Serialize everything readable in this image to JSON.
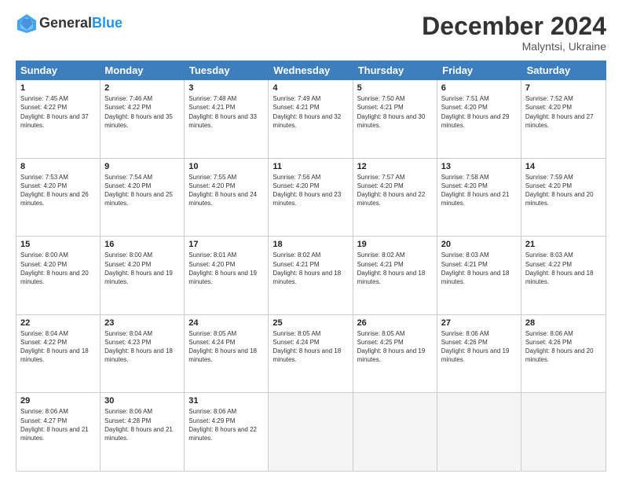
{
  "header": {
    "logo_general": "General",
    "logo_blue": "Blue",
    "month_title": "December 2024",
    "location": "Malyntsi, Ukraine"
  },
  "weekdays": [
    "Sunday",
    "Monday",
    "Tuesday",
    "Wednesday",
    "Thursday",
    "Friday",
    "Saturday"
  ],
  "rows": [
    [
      {
        "day": "1",
        "sunrise": "7:45 AM",
        "sunset": "4:22 PM",
        "daylight": "8 hours and 37 minutes."
      },
      {
        "day": "2",
        "sunrise": "7:46 AM",
        "sunset": "4:22 PM",
        "daylight": "8 hours and 35 minutes."
      },
      {
        "day": "3",
        "sunrise": "7:48 AM",
        "sunset": "4:21 PM",
        "daylight": "8 hours and 33 minutes."
      },
      {
        "day": "4",
        "sunrise": "7:49 AM",
        "sunset": "4:21 PM",
        "daylight": "8 hours and 32 minutes."
      },
      {
        "day": "5",
        "sunrise": "7:50 AM",
        "sunset": "4:21 PM",
        "daylight": "8 hours and 30 minutes."
      },
      {
        "day": "6",
        "sunrise": "7:51 AM",
        "sunset": "4:20 PM",
        "daylight": "8 hours and 29 minutes."
      },
      {
        "day": "7",
        "sunrise": "7:52 AM",
        "sunset": "4:20 PM",
        "daylight": "8 hours and 27 minutes."
      }
    ],
    [
      {
        "day": "8",
        "sunrise": "7:53 AM",
        "sunset": "4:20 PM",
        "daylight": "8 hours and 26 minutes."
      },
      {
        "day": "9",
        "sunrise": "7:54 AM",
        "sunset": "4:20 PM",
        "daylight": "8 hours and 25 minutes."
      },
      {
        "day": "10",
        "sunrise": "7:55 AM",
        "sunset": "4:20 PM",
        "daylight": "8 hours and 24 minutes."
      },
      {
        "day": "11",
        "sunrise": "7:56 AM",
        "sunset": "4:20 PM",
        "daylight": "8 hours and 23 minutes."
      },
      {
        "day": "12",
        "sunrise": "7:57 AM",
        "sunset": "4:20 PM",
        "daylight": "8 hours and 22 minutes."
      },
      {
        "day": "13",
        "sunrise": "7:58 AM",
        "sunset": "4:20 PM",
        "daylight": "8 hours and 21 minutes."
      },
      {
        "day": "14",
        "sunrise": "7:59 AM",
        "sunset": "4:20 PM",
        "daylight": "8 hours and 20 minutes."
      }
    ],
    [
      {
        "day": "15",
        "sunrise": "8:00 AM",
        "sunset": "4:20 PM",
        "daylight": "8 hours and 20 minutes."
      },
      {
        "day": "16",
        "sunrise": "8:00 AM",
        "sunset": "4:20 PM",
        "daylight": "8 hours and 19 minutes."
      },
      {
        "day": "17",
        "sunrise": "8:01 AM",
        "sunset": "4:20 PM",
        "daylight": "8 hours and 19 minutes."
      },
      {
        "day": "18",
        "sunrise": "8:02 AM",
        "sunset": "4:21 PM",
        "daylight": "8 hours and 18 minutes."
      },
      {
        "day": "19",
        "sunrise": "8:02 AM",
        "sunset": "4:21 PM",
        "daylight": "8 hours and 18 minutes."
      },
      {
        "day": "20",
        "sunrise": "8:03 AM",
        "sunset": "4:21 PM",
        "daylight": "8 hours and 18 minutes."
      },
      {
        "day": "21",
        "sunrise": "8:03 AM",
        "sunset": "4:22 PM",
        "daylight": "8 hours and 18 minutes."
      }
    ],
    [
      {
        "day": "22",
        "sunrise": "8:04 AM",
        "sunset": "4:22 PM",
        "daylight": "8 hours and 18 minutes."
      },
      {
        "day": "23",
        "sunrise": "8:04 AM",
        "sunset": "4:23 PM",
        "daylight": "8 hours and 18 minutes."
      },
      {
        "day": "24",
        "sunrise": "8:05 AM",
        "sunset": "4:24 PM",
        "daylight": "8 hours and 18 minutes."
      },
      {
        "day": "25",
        "sunrise": "8:05 AM",
        "sunset": "4:24 PM",
        "daylight": "8 hours and 18 minutes."
      },
      {
        "day": "26",
        "sunrise": "8:05 AM",
        "sunset": "4:25 PM",
        "daylight": "8 hours and 19 minutes."
      },
      {
        "day": "27",
        "sunrise": "8:06 AM",
        "sunset": "4:26 PM",
        "daylight": "8 hours and 19 minutes."
      },
      {
        "day": "28",
        "sunrise": "8:06 AM",
        "sunset": "4:26 PM",
        "daylight": "8 hours and 20 minutes."
      }
    ],
    [
      {
        "day": "29",
        "sunrise": "8:06 AM",
        "sunset": "4:27 PM",
        "daylight": "8 hours and 21 minutes."
      },
      {
        "day": "30",
        "sunrise": "8:06 AM",
        "sunset": "4:28 PM",
        "daylight": "8 hours and 21 minutes."
      },
      {
        "day": "31",
        "sunrise": "8:06 AM",
        "sunset": "4:29 PM",
        "daylight": "8 hours and 22 minutes."
      },
      null,
      null,
      null,
      null
    ]
  ]
}
